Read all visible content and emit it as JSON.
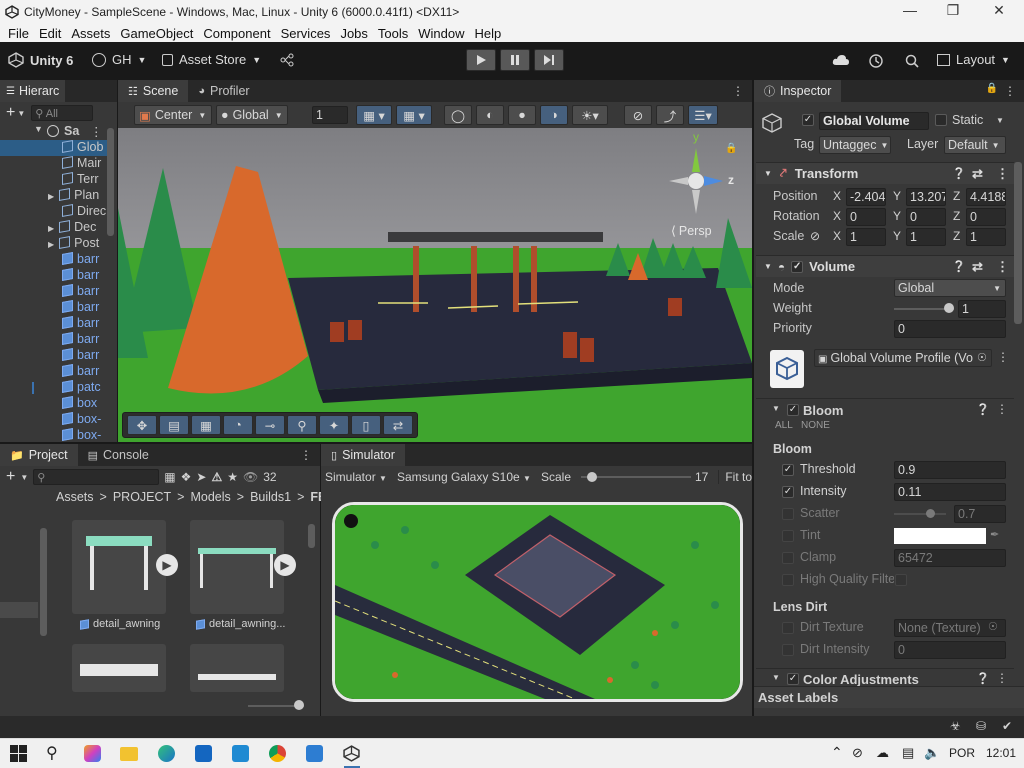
{
  "window": {
    "title": "CityMoney - SampleScene - Windows, Mac, Linux - Unity 6 (6000.0.41f1) <DX11>"
  },
  "menu": [
    "File",
    "Edit",
    "Assets",
    "GameObject",
    "Component",
    "Services",
    "Jobs",
    "Tools",
    "Window",
    "Help"
  ],
  "toolbar": {
    "account": "Unity 6",
    "org": "GH",
    "asset_store": "Asset Store",
    "layout": "Layout"
  },
  "hierarchy": {
    "tab": "Hierarc",
    "search_placeholder": "All",
    "scene": "Sa",
    "items": [
      "Glob",
      "Mair",
      "Terr",
      "Plan",
      "Direc",
      "Dec",
      "Post",
      "barr",
      "barr",
      "barr",
      "barr",
      "barr",
      "barr",
      "barr",
      "barr",
      "patc",
      "box",
      "box-",
      "box-"
    ]
  },
  "scene": {
    "tabs": [
      "Scene",
      "Profiler"
    ],
    "pivot": "Center",
    "space": "Global",
    "grid_value": "1",
    "persp": "Persp",
    "gizmo": {
      "y": "y",
      "z": "z"
    }
  },
  "project": {
    "tabs": [
      "Project",
      "Console"
    ],
    "count": "32",
    "breadcrumb": [
      "Assets",
      "PROJECT",
      "Models",
      "Builds1",
      "FBX"
    ],
    "assets": [
      "detail_awning",
      "detail_awning..."
    ]
  },
  "simulator": {
    "tab": "Simulator",
    "mode": "Simulator",
    "device": "Samsung Galaxy S10e",
    "scale_label": "Scale",
    "scale_value": "17",
    "fit": "Fit to"
  },
  "inspector": {
    "tab": "Inspector",
    "object_name": "Global Volume",
    "static": "Static",
    "tag_label": "Tag",
    "tag_value": "Untaggec",
    "layer_label": "Layer",
    "layer_value": "Default",
    "transform": {
      "title": "Transform",
      "rows": [
        {
          "label": "Position",
          "x": "-2.404",
          "y": "13.207",
          "z": "4.4188"
        },
        {
          "label": "Rotation",
          "x": "0",
          "y": "0",
          "z": "0"
        },
        {
          "label": "Scale",
          "x": "1",
          "y": "1",
          "z": "1"
        }
      ]
    },
    "volume": {
      "title": "Volume",
      "mode_label": "Mode",
      "mode": "Global",
      "weight_label": "Weight",
      "weight": "1",
      "weight_fraction": 1.0,
      "priority_label": "Priority",
      "priority": "0",
      "profile": "Global Volume Profile (Vo"
    },
    "bloom": {
      "title": "Bloom",
      "all": "ALL",
      "none": "NONE",
      "section": "Bloom",
      "threshold_label": "Threshold",
      "threshold": "0.9",
      "intensity_label": "Intensity",
      "intensity": "0.11",
      "scatter_label": "Scatter",
      "scatter": "0.7",
      "scatter_fraction": 0.7,
      "tint_label": "Tint",
      "clamp_label": "Clamp",
      "clamp": "65472",
      "hq_label": "High Quality Filte",
      "lens_dirt": "Lens Dirt",
      "dirt_texture_label": "Dirt Texture",
      "dirt_texture": "None (Texture)",
      "dirt_intensity_label": "Dirt Intensity",
      "dirt_intensity": "0"
    },
    "color_adjustments": "Color Adjustments",
    "asset_labels": "Asset Labels"
  },
  "taskbar": {
    "lang": "POR",
    "time": "12:01"
  },
  "colors": {
    "accent": "#3a72b0",
    "panel": "#383838",
    "grass": "#3fa52e",
    "tree": "#d8692c"
  }
}
